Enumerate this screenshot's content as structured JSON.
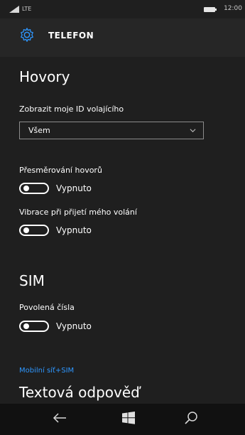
{
  "status_bar": {
    "network": "LTE",
    "time": "12:00"
  },
  "header": {
    "title": "TELEFON",
    "icon": "gear-icon"
  },
  "calls_section": {
    "title": "Hovory",
    "caller_id": {
      "label": "Zobrazit moje ID volajícího",
      "value": "Všem"
    },
    "forwarding": {
      "label": "Přesměrování hovorů",
      "state": "Vypnuto",
      "on": false
    },
    "vibration": {
      "label": "Vibrace při přijetí mého volání",
      "state": "Vypnuto",
      "on": false
    }
  },
  "sim_section": {
    "title": "SIM",
    "fixed_dialing": {
      "label": "Povolená čísla",
      "state": "Vypnuto",
      "on": false
    },
    "link": "Mobilní síť+SIM"
  },
  "text_reply_section": {
    "title": "Textová odpověď"
  },
  "nav": {
    "back": "back-arrow-icon",
    "start": "windows-logo-icon",
    "search": "search-icon"
  },
  "colors": {
    "accent": "#2e97ff",
    "background": "#1f1f1f",
    "header": "#262626"
  }
}
